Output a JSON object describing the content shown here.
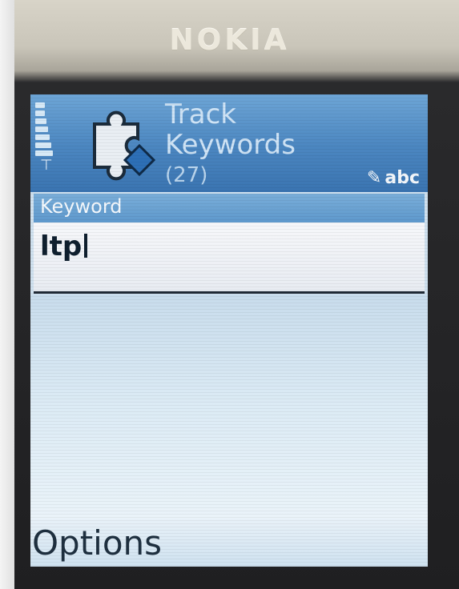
{
  "device": {
    "brand": "NOKIA"
  },
  "header": {
    "title_line1": "Track",
    "title_line2": "Keywords",
    "count": "(27)",
    "input_mode": "abc"
  },
  "form": {
    "field_label": "Keyword",
    "field_value": "ltp"
  },
  "softkeys": {
    "left": "Options"
  },
  "colors": {
    "header_blue": "#4b86c0",
    "label_blue": "#6da5d6",
    "input_bg": "#f6f7fa"
  },
  "icons": {
    "app_icon": "puzzle-piece-icon",
    "signal": "signal-strength-icon",
    "antenna": "antenna-icon",
    "input_mode_icon": "pen-input-icon"
  }
}
